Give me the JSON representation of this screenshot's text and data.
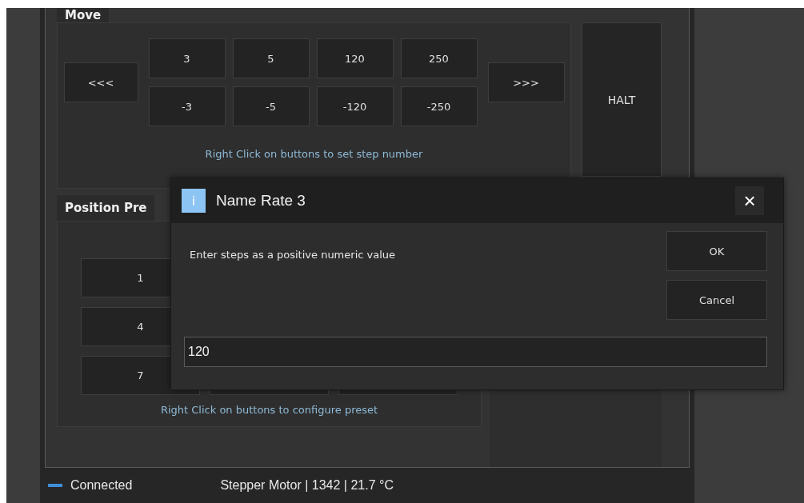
{
  "move": {
    "title": "Move",
    "back": "<<<",
    "forward": ">>>",
    "steps_positive": [
      "3",
      "5",
      "120",
      "250"
    ],
    "steps_negative": [
      "-3",
      "-5",
      "-120",
      "-250"
    ],
    "hint": "Right Click on buttons to set step number",
    "halt": "HALT"
  },
  "presets": {
    "title": "Position Pre",
    "rows": [
      {
        "label": "1"
      },
      {
        "label": "4"
      },
      {
        "label": "7"
      }
    ],
    "hint": "Right Click on buttons to configure preset"
  },
  "status_bar": {
    "connected": true,
    "connection": "Connected",
    "device": "Stepper Motor | 1342 | 21.7 °C"
  },
  "dialog": {
    "icon": "i",
    "title": "Name Rate 3",
    "close": "×",
    "message": "Enter steps as a positive numeric value",
    "value": "120",
    "buttons": [
      "OK",
      "Cancel"
    ]
  }
}
